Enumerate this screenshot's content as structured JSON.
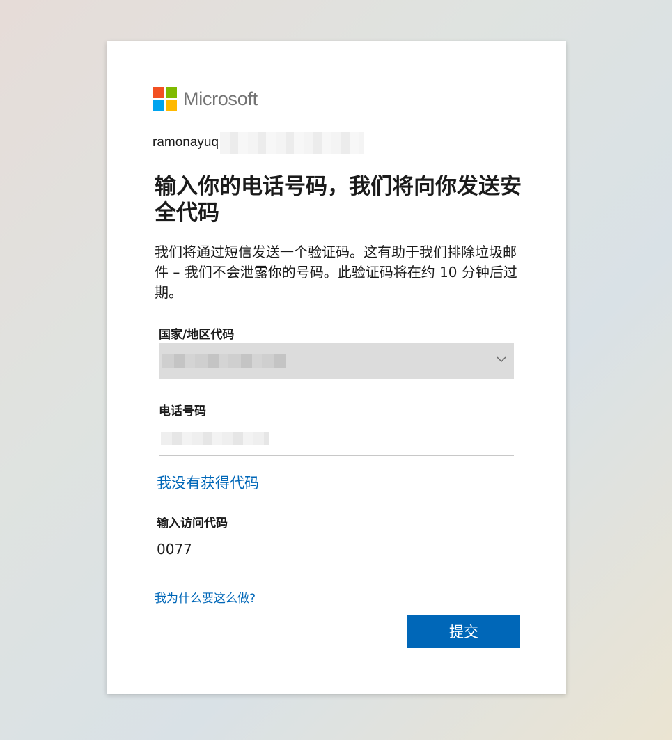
{
  "logo": {
    "text": "Microsoft",
    "colors": [
      "#f25022",
      "#7fba00",
      "#00a4ef",
      "#ffb900"
    ]
  },
  "identity": {
    "email_prefix": "ramonayuq"
  },
  "title": "输入你的电话号码，我们将向你发送安全代码",
  "description": "我们将通过短信发送一个验证码。这有助于我们排除垃圾邮件 – 我们不会泄露你的号码。此验证码将在约 10 分钟后过期。",
  "country_field": {
    "label": "国家/地区代码"
  },
  "phone_field": {
    "label": "电话号码"
  },
  "no_code_link": "我没有获得代码",
  "access_code": {
    "label": "输入访问代码",
    "value": "0077"
  },
  "why_link": "我为什么要这么做?",
  "submit_label": "提交",
  "accent_color": "#0067b8"
}
